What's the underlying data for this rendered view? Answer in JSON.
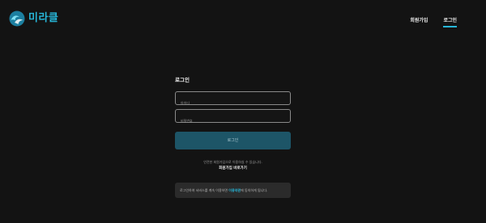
{
  "header": {
    "brand": "미라클",
    "nav": [
      {
        "label": "회원가입"
      },
      {
        "label": "로그인"
      }
    ]
  },
  "login": {
    "title": "로그인",
    "id_placeholder": "아이디",
    "password_placeholder": "비밀번호",
    "button_label": "로그인",
    "hint": "안전한 회원가입으로 이용하실 수 있습니다.",
    "signup_link": "회원가입 바로가기"
  },
  "notice": {
    "prefix": "로그인하여 서비스를 계속 이용하면 ",
    "highlight": "이용약관",
    "suffix": "에 동의하게 됩니다."
  },
  "colors": {
    "background": "#131313",
    "accent": "#27b6d8",
    "button": "#1d5567",
    "notice_bg": "#2b2b2b"
  }
}
